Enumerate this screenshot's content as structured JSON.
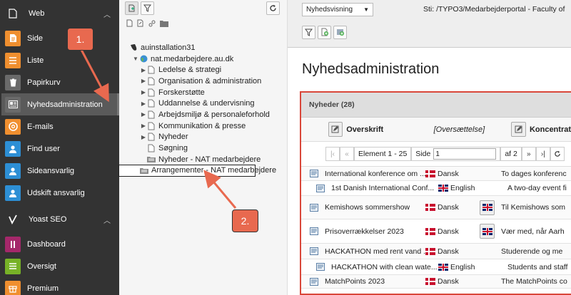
{
  "module_menu": {
    "web_group": {
      "title": "Web",
      "icon": "page-icon"
    },
    "web_items": [
      {
        "label": "Side",
        "icon": "page-module-icon",
        "color": "#f08f2f"
      },
      {
        "label": "Liste",
        "icon": "list-module-icon",
        "color": "#f08f2f"
      },
      {
        "label": "Papirkurv",
        "icon": "trash-icon",
        "color": "#6a6a6a"
      },
      {
        "label": "Nyhedsadministration",
        "icon": "news-icon",
        "color": "#6a6a6a",
        "active": true
      },
      {
        "label": "E-mails",
        "icon": "email-icon",
        "color": "#f08f2f"
      },
      {
        "label": "Find user",
        "icon": "user-icon",
        "color": "#2d8fd5"
      },
      {
        "label": "Sideansvarlig",
        "icon": "user-icon",
        "color": "#2d8fd5"
      },
      {
        "label": "Udskift ansvarlig",
        "icon": "user-icon",
        "color": "#2d8fd5"
      }
    ],
    "yoast_group": {
      "title": "Yoast SEO",
      "icon": "yoast-icon"
    },
    "yoast_items": [
      {
        "label": "Dashboard",
        "icon": "dashboard-icon",
        "color": "#a4286a"
      },
      {
        "label": "Oversigt",
        "icon": "overview-icon",
        "color": "#77b227"
      },
      {
        "label": "Premium",
        "icon": "premium-icon",
        "color": "#f08f2f"
      }
    ]
  },
  "page_tree": {
    "root": "auinstallation31",
    "site": "nat.medarbejdere.au.dk",
    "pages": [
      {
        "label": "Ledelse & strategi",
        "expandable": true
      },
      {
        "label": "Organisation & administration",
        "expandable": true
      },
      {
        "label": "Forskerstøtte",
        "expandable": true
      },
      {
        "label": "Uddannelse & undervisning",
        "expandable": true
      },
      {
        "label": "Arbejdsmiljø & personaleforhold",
        "expandable": true
      },
      {
        "label": "Kommunikation & presse",
        "expandable": true
      },
      {
        "label": "Nyheder",
        "expandable": true
      },
      {
        "label": "Søgning",
        "expandable": false
      },
      {
        "label": "Nyheder - NAT medarbejdere",
        "expandable": false,
        "folder": true
      },
      {
        "label": "Arrangementer - NAT medarbejdere",
        "expandable": false,
        "folder": true,
        "selected": true
      }
    ]
  },
  "docheader": {
    "view_select": "Nyhedsvisning",
    "path_label": "Sti: /TYPO3/Medarbejderportal - Faculty of"
  },
  "main": {
    "title": "Nyhedsadministration",
    "panel_title": "Nyheder (28)",
    "columns": {
      "headline": "Overskrift",
      "translation": "[Oversættelse]",
      "concentrate": "Koncentrat"
    },
    "pager": {
      "range": "Element 1 - 25",
      "page_label": "Side",
      "page_value": "1",
      "of_label": "af 2"
    },
    "rows": [
      {
        "title": "International konference om ...",
        "lang": "Dansk",
        "flag": "dk",
        "translate_btn": false,
        "teaser": "To dages konferenc"
      },
      {
        "title": "1st Danish International Conf...",
        "lang": "English",
        "flag": "uk",
        "translate_btn": false,
        "teaser": "A two-day event fi"
      },
      {
        "title": "Kemishows sommershow",
        "lang": "Dansk",
        "flag": "dk",
        "translate_btn": true,
        "teaser": "Til Kemishows som"
      },
      {
        "title": "Prisoverrækkelser 2023",
        "lang": "Dansk",
        "flag": "dk",
        "translate_btn": true,
        "teaser": "Vær med, når Aarh"
      },
      {
        "title": "HACKATHON med rent vand ...",
        "lang": "Dansk",
        "flag": "dk",
        "translate_btn": false,
        "teaser": "Studerende og me"
      },
      {
        "title": "HACKATHON with clean wate...",
        "lang": "English",
        "flag": "uk",
        "translate_btn": false,
        "teaser": "Students and staff"
      },
      {
        "title": "MatchPoints 2023",
        "lang": "Dansk",
        "flag": "dk",
        "translate_btn": false,
        "teaser": "The MatchPoints co"
      }
    ]
  },
  "annotations": {
    "callout1": "1.",
    "callout2": "2.",
    "color": "#e8694f"
  }
}
